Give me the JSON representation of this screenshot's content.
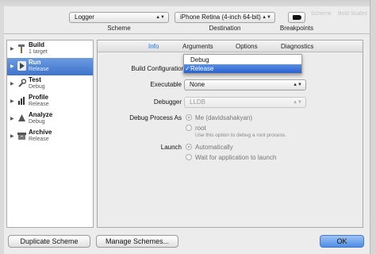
{
  "toolbar": {
    "scheme_value": "Logger",
    "scheme_caption": "Scheme",
    "destination_value": "iPhone Retina (4-inch 64-bit)",
    "destination_caption": "Destination",
    "breakpoints_caption": "Breakpoints"
  },
  "background": {
    "ghost_left": "Scheme",
    "ghost_right": "Bold Scales"
  },
  "sidebar": {
    "items": [
      {
        "name": "Build",
        "sub": "1 target",
        "icon": "hammer-icon"
      },
      {
        "name": "Run",
        "sub": "Release",
        "icon": "play-icon"
      },
      {
        "name": "Test",
        "sub": "Debug",
        "icon": "wrench-icon"
      },
      {
        "name": "Profile",
        "sub": "Release",
        "icon": "instruments-icon"
      },
      {
        "name": "Analyze",
        "sub": "Debug",
        "icon": "analyze-icon"
      },
      {
        "name": "Archive",
        "sub": "Release",
        "icon": "archive-icon"
      }
    ]
  },
  "tabs": [
    "Info",
    "Arguments",
    "Options",
    "Diagnostics"
  ],
  "info": {
    "build_config_label": "Build Configuration",
    "executable_label": "Executable",
    "executable_value": "None",
    "debugger_label": "Debugger",
    "debugger_value": "LLDB",
    "debug_process_label": "Debug Process As",
    "me_option": "Me (davidsahakyan)",
    "root_option": "root",
    "root_note": "Use this option to debug a root process.",
    "launch_label": "Launch",
    "auto_option": "Automatically",
    "wait_option": "Wait for application to launch"
  },
  "menu": {
    "items": [
      "Debug",
      "Release"
    ],
    "selected": "Release",
    "check": "✓"
  },
  "buttons": {
    "duplicate": "Duplicate Scheme",
    "manage": "Manage Schemes...",
    "ok": "OK"
  },
  "colors": {
    "accent": "#3f73cc",
    "tab_active": "#2f6fd6"
  }
}
